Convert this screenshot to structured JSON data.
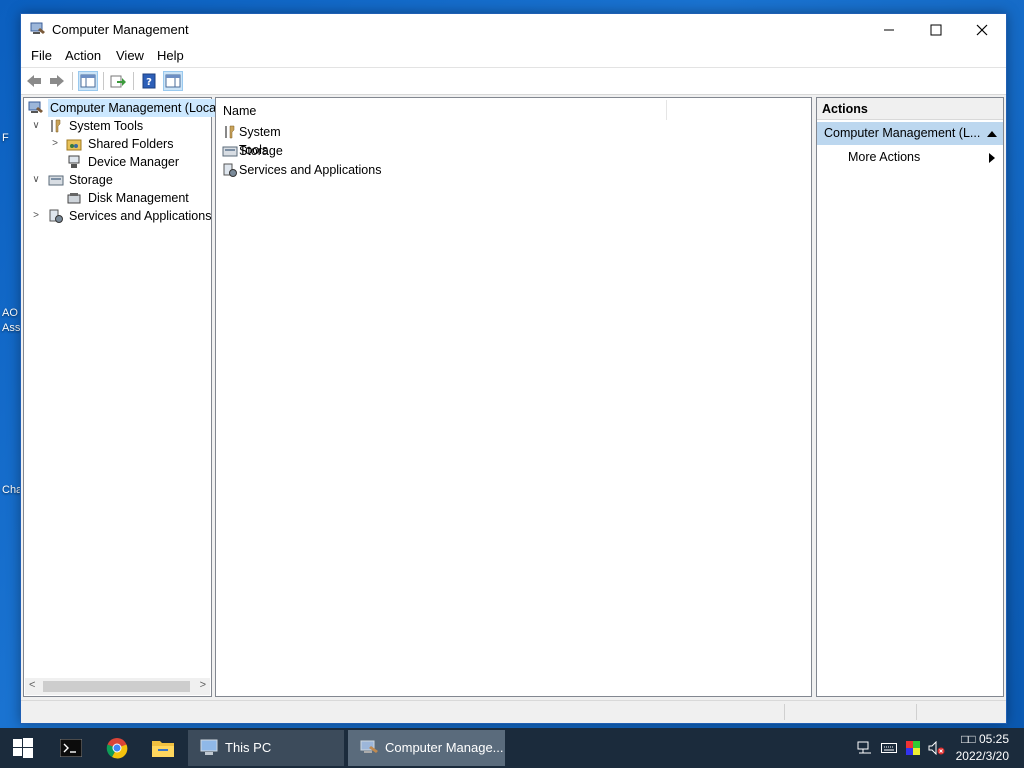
{
  "desktop": {
    "labels": [
      "F",
      "AO",
      "Ass",
      "Cha"
    ]
  },
  "window": {
    "title": "Computer Management",
    "controls": {
      "minimize": "minimize",
      "maximize": "maximize",
      "close": "close"
    }
  },
  "menu": [
    "File",
    "Action",
    "View",
    "Help"
  ],
  "toolbar": {
    "icons": [
      "back-arrow-icon",
      "forward-arrow-icon",
      "show-hide-console-tree-icon",
      "export-list-icon",
      "help-icon",
      "show-hide-action-pane-icon"
    ]
  },
  "tree": {
    "root": "Computer Management (Local",
    "system_tools": "System Tools",
    "shared_folders": "Shared Folders",
    "device_manager": "Device Manager",
    "storage": "Storage",
    "disk_management": "Disk Management",
    "services_apps": "Services and Applications",
    "expander_expanded": "∨",
    "expander_collapsed": ">"
  },
  "list": {
    "column_name": "Name",
    "items": [
      "System Tools",
      "Storage",
      "Services and Applications"
    ]
  },
  "actions": {
    "header": "Actions",
    "section": "Computer Management (L...",
    "more_actions": "More Actions"
  },
  "taskbar": {
    "this_pc": "This PC",
    "computer_management": "Computer Manage...",
    "time": "05:25",
    "date": "2022/3/20",
    "time_prefix": "□□"
  }
}
